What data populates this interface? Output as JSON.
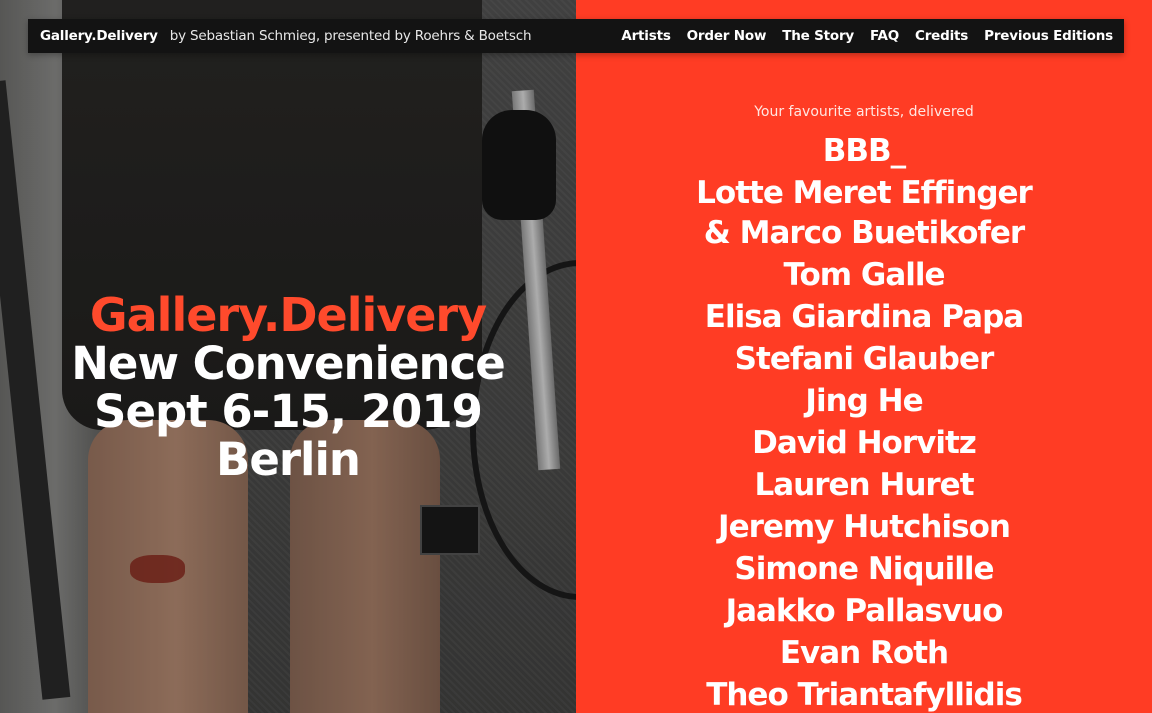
{
  "nav": {
    "brand": "Gallery.Delivery",
    "byline": "by Sebastian Schmieg, presented by Roehrs & Boetsch",
    "links": [
      "Artists",
      "Order Now",
      "The Story",
      "FAQ",
      "Credits",
      "Previous Editions"
    ]
  },
  "hero": {
    "title": "Gallery.Delivery",
    "subtitle": "New Convenience",
    "dates": "Sept 6-15, 2019",
    "city": "Berlin"
  },
  "artists": {
    "tagline": "Your favourite artists, delivered",
    "names": [
      "BBB_",
      "Lotte Meret Effinger & Marco Buetikofer",
      "Tom Galle",
      "Elisa Giardina Papa",
      "Stefani Glauber",
      "Jing He",
      "David Horvitz",
      "Lauren Huret",
      "Jeremy Hutchison",
      "Simone Niquille",
      "Jaakko Pallasvuo",
      "Evan Roth",
      "Theo Triantafyllidis"
    ]
  },
  "colors": {
    "accent": "#ff3c24",
    "navbar": "#131313",
    "text": "#ffffff"
  }
}
